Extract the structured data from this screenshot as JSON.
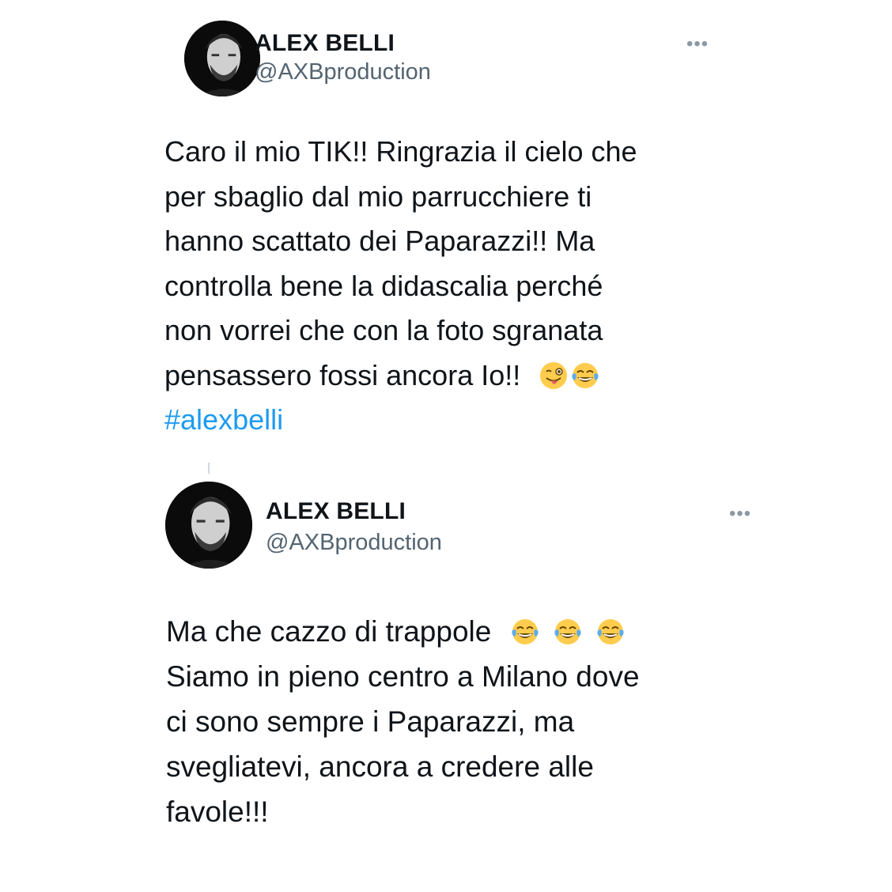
{
  "tweets": [
    {
      "name": "ALEX BELLI",
      "handle": "@AXBproduction",
      "more": "•••",
      "lines": [
        "Caro il mio TIK!! Ringrazia il cielo che",
        "per sbaglio dal mio parrucchiere ti",
        "hanno scattato dei Paparazzi!! Ma",
        "controlla bene la didascalia perché",
        "non vorrei che con la foto sgranata",
        "pensassero fossi ancora Io!!"
      ],
      "hashtag": "#alexbelli",
      "emojis": [
        "winking-tongue-emoji",
        "tears-of-joy-emoji"
      ]
    },
    {
      "name": "ALEX BELLI",
      "handle": "@AXBproduction",
      "more": "•••",
      "lines": [
        "Ma che cazzo di trappole",
        "Siamo in pieno centro a Milano dove",
        "ci sono sempre i Paparazzi, ma",
        "svegliatevi, ancora a credere alle",
        "favole!!!"
      ],
      "emojis": [
        "tears-of-joy-emoji",
        "tears-of-joy-emoji",
        "tears-of-joy-emoji"
      ]
    }
  ],
  "colors": {
    "text": "#0f1419",
    "handle": "#536471",
    "hashtag": "#1d9bf0",
    "more": "#8b98a5"
  }
}
